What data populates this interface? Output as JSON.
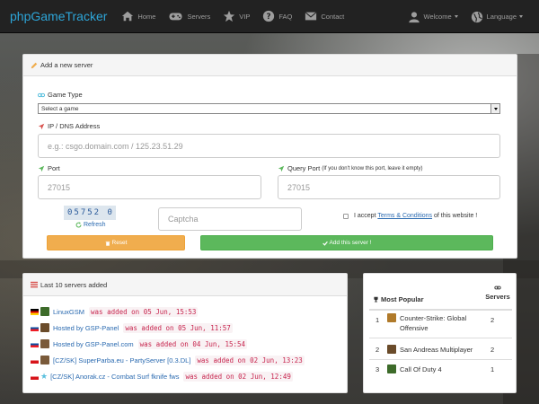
{
  "navbar": {
    "brand": "phpGameTracker",
    "items": [
      {
        "label": "Home",
        "icon": "home-icon"
      },
      {
        "label": "Servers",
        "icon": "gamepad-icon"
      },
      {
        "label": "VIP",
        "icon": "star-icon"
      },
      {
        "label": "FAQ",
        "icon": "question-circle-icon"
      },
      {
        "label": "Contact",
        "icon": "envelope-icon"
      }
    ],
    "welcome": "Welcome",
    "language": "Language"
  },
  "add_server": {
    "title": "Add a new server",
    "game_type_label": "Game Type",
    "game_select_value": "Select a game",
    "address_label": "IP / DNS Address",
    "address_placeholder": "e.g.: csgo.domain.com / 125.23.51.29",
    "port_label": "Port",
    "port_placeholder": "27015",
    "query_port_label": "Query Port",
    "query_port_note": "(If you don't know this port, leave it empty)",
    "query_port_placeholder": "27015",
    "captcha_text": "05752 0",
    "refresh_label": "Refresh",
    "captcha_placeholder": "Captcha",
    "terms_prefix": "I accept",
    "terms_link": "Terms & Conditions",
    "terms_suffix": "of this website !",
    "reset_label": "Reset",
    "submit_label": "Add this server !"
  },
  "last_servers": {
    "title": "Last 10 servers added",
    "rows": [
      {
        "name": "LinuxGSM",
        "added": "was added on 05 Jun, 15:53"
      },
      {
        "name": "Hosted by GSP-Panel",
        "added": "was added on 05 Jun, 11:57"
      },
      {
        "name": "Hosted by GSP-Panel.com",
        "added": "was added on 04 Jun, 15:54"
      },
      {
        "name": "[CZ/SK] SuperParba.eu - PartyServer [0.3.DL]",
        "added": "was added on 02 Jun, 13:23"
      },
      {
        "name": "[CZ/SK] Anorak.cz - Combat Surf fknife fws",
        "added": "was added on 02 Jun, 12:49"
      }
    ]
  },
  "popular": {
    "title": "Most Popular",
    "servers_header": "Servers",
    "rows": [
      {
        "rank": "1",
        "game": "Counter-Strike: Global Offensive",
        "servers": "2"
      },
      {
        "rank": "2",
        "game": "San Andreas Multiplayer",
        "servers": "2"
      },
      {
        "rank": "3",
        "game": "Call Of Duty 4",
        "servers": "1"
      }
    ]
  },
  "colors": {
    "brand": "#2da5d8",
    "warning": "#f0ad4e",
    "success": "#5cb85c",
    "link": "#2a6ab0",
    "code": "#c7254e"
  }
}
